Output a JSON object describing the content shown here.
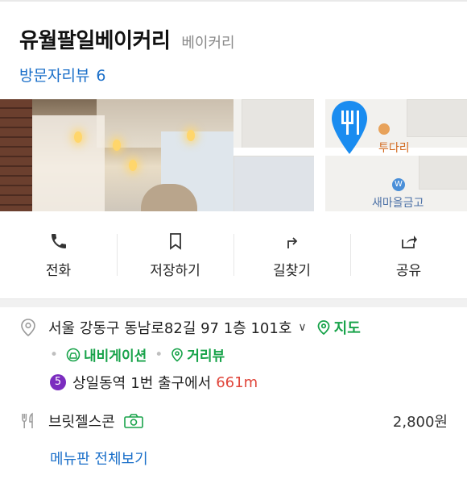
{
  "place": {
    "name": "유월팔일베이커리",
    "category": "베이커리",
    "review_label": "방문자리뷰",
    "review_count": "6"
  },
  "photos": {
    "map_labels": [
      "투다리",
      "새마을금고"
    ]
  },
  "actions": [
    {
      "label": "전화",
      "icon": "phone-icon"
    },
    {
      "label": "저장하기",
      "icon": "bookmark-icon"
    },
    {
      "label": "길찾기",
      "icon": "directions-icon"
    },
    {
      "label": "공유",
      "icon": "share-icon"
    }
  ],
  "info": {
    "address": "서울 강동구 동남로82길 97 1층 101호",
    "map_link": "지도",
    "navigation_link": "내비게이션",
    "street_view_link": "거리뷰",
    "subway_line": "5",
    "station": "상일동역",
    "exit": "1번 출구에서",
    "distance": "661m"
  },
  "menu": {
    "item_name": "브릿젤스콘",
    "item_price": "2,800원",
    "view_all": "메뉴판 전체보기"
  },
  "colors": {
    "link_blue": "#1a6fc9",
    "green": "#18a34a",
    "distance_red": "#e0463b",
    "line5_purple": "#7b2cbf",
    "pin_blue": "#1a8cf0"
  }
}
